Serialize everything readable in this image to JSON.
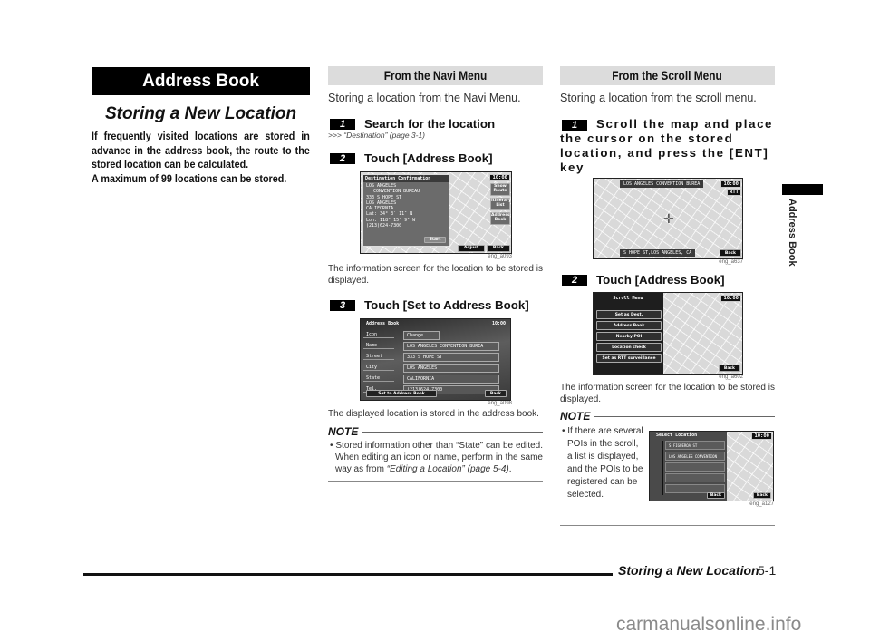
{
  "chapter": {
    "banner": "Address Book",
    "section_title": "Storing a New Location",
    "intro": "If frequently visited locations are stored in advance in the address book, the route to the stored location can be calculated.",
    "intro_max": "A maximum of 99 locations can be stored."
  },
  "navi_menu": {
    "header": "From the Navi Menu",
    "lead": "Storing a location from the Navi Menu.",
    "steps": [
      {
        "num": "1",
        "title": "Search for the location",
        "ref": ">>> “Destination” (page 3-1)"
      },
      {
        "num": "2",
        "title": "Touch [Address Book]"
      },
      {
        "num": "3",
        "title": "Touch [Set to Address Book]"
      }
    ],
    "screen1": {
      "title": "Destination Confirmation",
      "lines": [
        "LOS ANGELES",
        "CONVENTION BUREAU",
        "333 S HOPE ST",
        "LOS ANGELES",
        "CALIFORNIA",
        "Lat:  34°  3′ 11″ N",
        "Lon: 118° 15′  9″ W",
        "(213)624-7300"
      ],
      "start": "Start",
      "clock": "10:00",
      "side_buttons": [
        "Show Route",
        "Itinerary List",
        "Address Book"
      ],
      "adjust": "Adjust",
      "back": "Back",
      "caption": "eng_a093"
    },
    "step2_text": "The information screen for the location to be stored is displayed.",
    "screen2": {
      "title": "Address Book",
      "clock": "10:00",
      "rows": [
        {
          "label": "Icon",
          "value": "Change"
        },
        {
          "label": "Name",
          "value": "LOS ANGELES CONVENTION BUREA"
        },
        {
          "label": "Street",
          "value": "333 S HOPE ST"
        },
        {
          "label": "City",
          "value": "LOS ANGELES"
        },
        {
          "label": "State",
          "value": "CALIFORNIA"
        },
        {
          "label": "Tel.",
          "value": "(213)624-7300"
        }
      ],
      "set_button": "Set to Address Book",
      "back": "Back",
      "caption": "eng_a098"
    },
    "step3_text": "The displayed location is stored in the address book.",
    "note_label": "NOTE",
    "note_text": "Stored information other than “State” can be edited. When editing an icon or name, perform in the same way as from ",
    "note_ref": "“Editing a Location” (page 5-4)",
    "note_end": "."
  },
  "scroll_menu": {
    "header": "From the Scroll Menu",
    "lead": "Storing a location from the scroll menu.",
    "steps": [
      {
        "num": "1",
        "title": "Scroll the map and place the cursor on the stored location, and press the [ENT] key"
      },
      {
        "num": "2",
        "title": "Touch [Address Book]"
      }
    ],
    "screen1": {
      "top_label": "LOS ANGELES CONVENTION BUREA",
      "bottom_label": "S HOPE ST,LOS ANGELES, CA",
      "clock": "10:00",
      "rtt": "RTT",
      "back": "Back",
      "caption": "eng_a637"
    },
    "screen2": {
      "title": "Scroll Menu",
      "items": [
        "Set as Dest.",
        "Address Book",
        "Nearby POI",
        "Location check",
        "Set as RTT surveillance"
      ],
      "clock": "10:00",
      "back": "Back",
      "caption": "eng_a602"
    },
    "step2_text": "The information screen for the location to be stored is displayed.",
    "note_label": "NOTE",
    "note_text": "If there are several POIs in the scroll, a list is displayed, and the POIs to be registered can be selected.",
    "screen3": {
      "title": "Select Location",
      "items": [
        "S FIGUEROA ST",
        "LOS ANGELES CONVENTION"
      ],
      "clock": "10:00",
      "back": "Back",
      "caption": "eng_a127"
    }
  },
  "side_tab": "Address Book",
  "footer": {
    "title": "Storing a New Location",
    "page": "5-1"
  },
  "watermark": "carmanualsonline.info"
}
